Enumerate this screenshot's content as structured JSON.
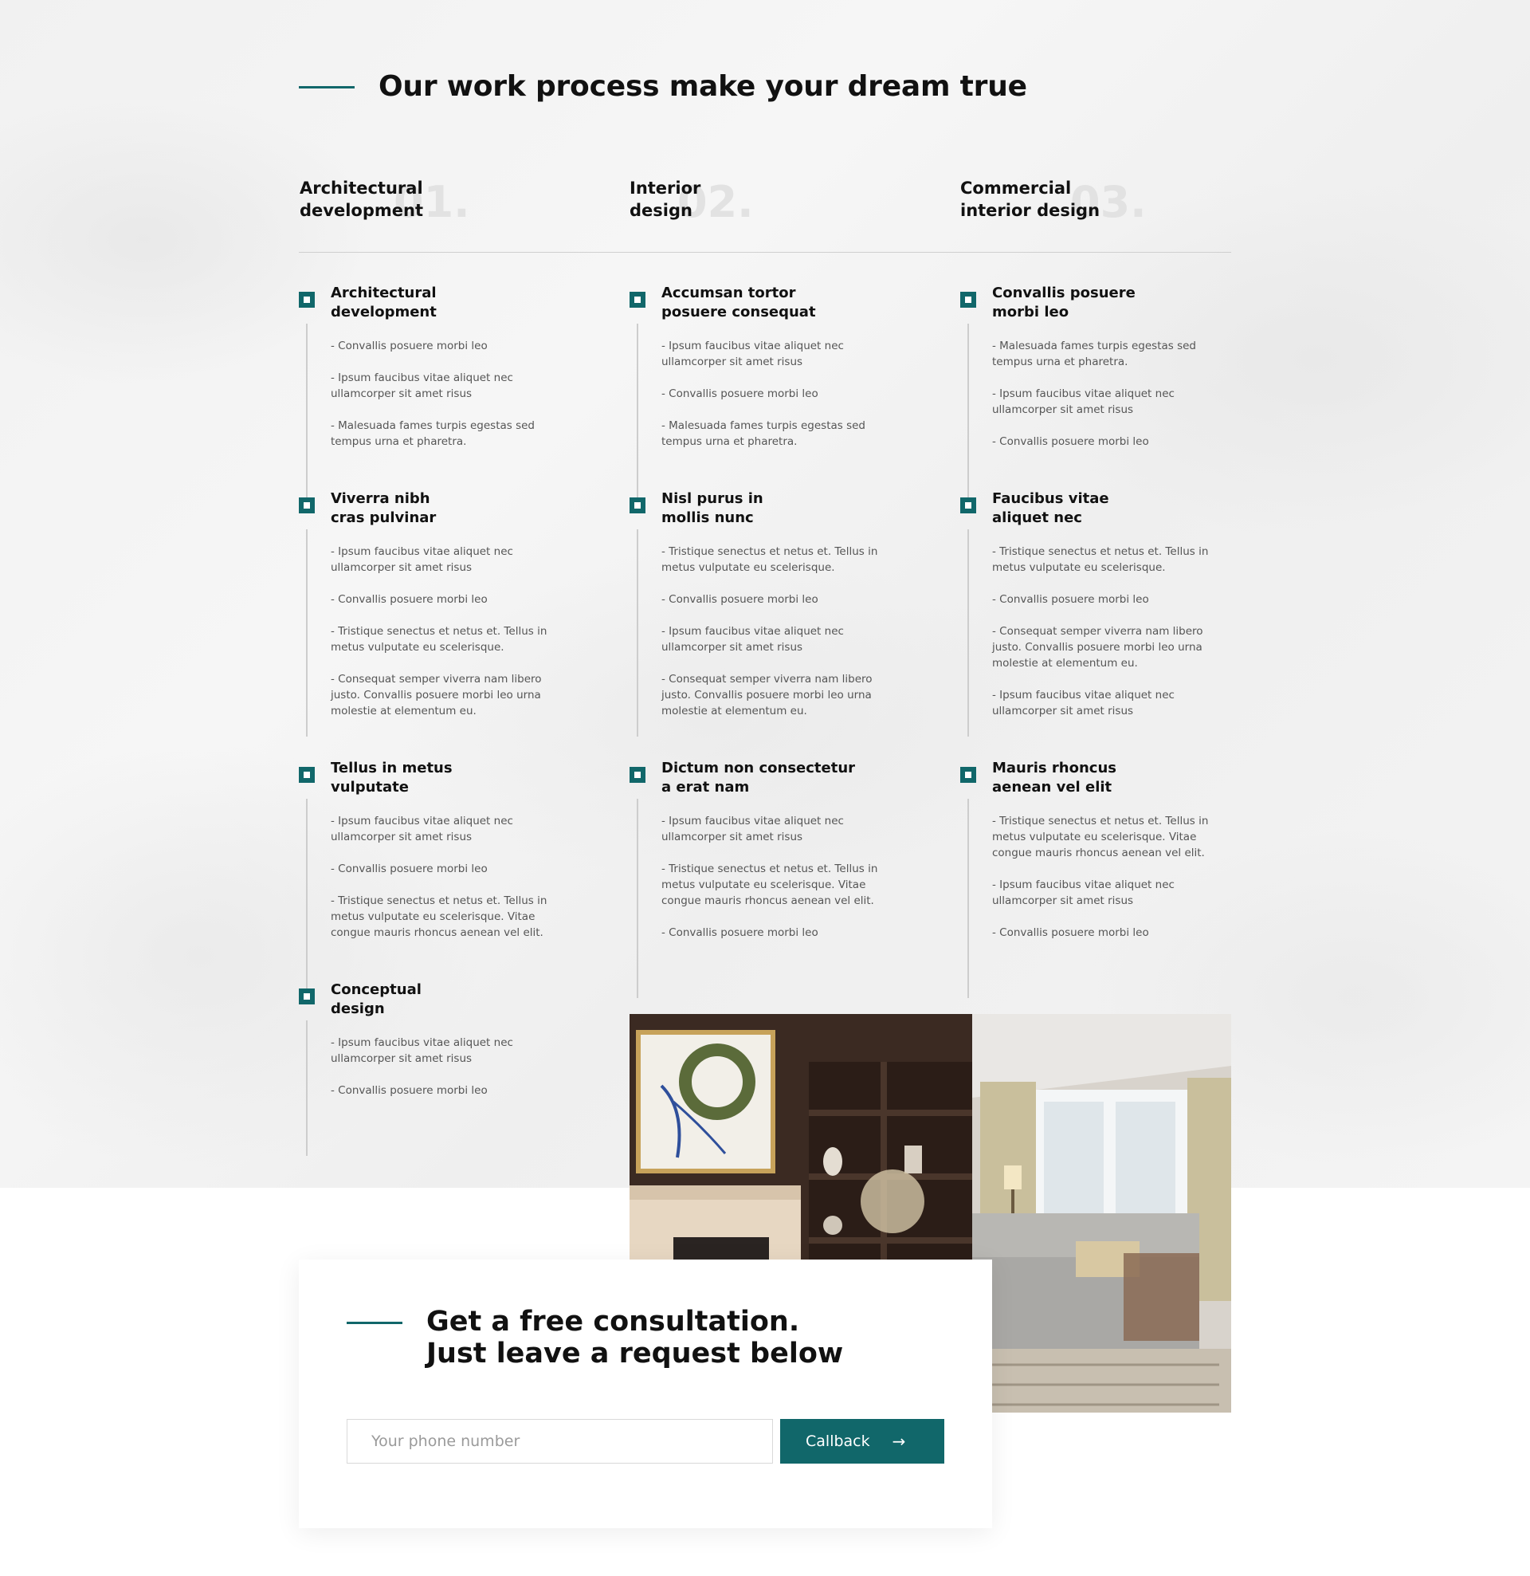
{
  "section": {
    "title": "Our work process make your dream true"
  },
  "colors": {
    "accent": "#11676a"
  },
  "categories": [
    {
      "number": "01.",
      "title": "Architectural\ndevelopment"
    },
    {
      "number": "02.",
      "title": "Interior\ndesign"
    },
    {
      "number": "03.",
      "title": "Commercial\ninterior design"
    }
  ],
  "columns": [
    {
      "steps": [
        {
          "title": "Architectural\ndevelopment",
          "items": [
            "- Convallis posuere morbi leo",
            "- Ipsum faucibus vitae aliquet nec ullamcorper sit amet risus",
            "- Malesuada fames turpis egestas sed tempus urna et pharetra."
          ]
        },
        {
          "title": "Viverra nibh\ncras pulvinar",
          "items": [
            "- Ipsum faucibus vitae aliquet nec ullamcorper sit amet risus",
            "- Convallis posuere morbi leo",
            "- Tristique senectus et netus et. Tellus in metus vulputate eu scelerisque.",
            "- Consequat semper viverra nam libero justo. Convallis posuere morbi leo urna molestie at elementum eu."
          ]
        },
        {
          "title": "Tellus in metus\nvulputate",
          "items": [
            "- Ipsum faucibus vitae aliquet nec ullamcorper sit amet risus",
            "- Convallis posuere morbi leo",
            "- Tristique senectus et netus et. Tellus in metus vulputate eu scelerisque. Vitae congue mauris rhoncus aenean vel elit."
          ]
        },
        {
          "title": "Conceptual\ndesign",
          "items": [
            "- Ipsum faucibus vitae aliquet nec ullamcorper sit amet risus",
            "- Convallis posuere morbi leo"
          ]
        }
      ]
    },
    {
      "steps": [
        {
          "title": "Accumsan tortor\nposuere consequat",
          "items": [
            "- Ipsum faucibus vitae aliquet nec ullamcorper sit amet risus",
            "- Convallis posuere morbi leo",
            "- Malesuada fames turpis egestas sed tempus urna et pharetra."
          ]
        },
        {
          "title": "Nisl purus in\nmollis nunc",
          "items": [
            "- Tristique senectus et netus et. Tellus in metus vulputate eu scelerisque.",
            "- Convallis posuere morbi leo",
            "- Ipsum faucibus vitae aliquet nec ullamcorper sit amet risus",
            "- Consequat semper viverra nam libero justo. Convallis posuere morbi leo urna molestie at elementum eu."
          ]
        },
        {
          "title": "Dictum non consectetur\na erat nam",
          "items": [
            "- Ipsum faucibus vitae aliquet nec ullamcorper sit amet risus",
            "- Tristique senectus et netus et. Tellus in metus vulputate eu scelerisque. Vitae congue mauris rhoncus aenean vel elit.",
            "- Convallis posuere morbi leo"
          ]
        }
      ]
    },
    {
      "steps": [
        {
          "title": "Convallis posuere\nmorbi leo",
          "items": [
            "- Malesuada fames turpis egestas sed tempus urna et pharetra.",
            "- Ipsum faucibus vitae aliquet nec ullamcorper sit amet risus",
            "- Convallis posuere morbi leo"
          ]
        },
        {
          "title": "Faucibus vitae\naliquet nec",
          "items": [
            "- Tristique senectus et netus et. Tellus in metus vulputate eu scelerisque.",
            "- Convallis posuere morbi leo",
            "- Consequat semper viverra nam libero justo. Convallis posuere morbi leo urna molestie at elementum eu.",
            "- Ipsum faucibus vitae aliquet nec ullamcorper sit amet risus"
          ]
        },
        {
          "title": "Mauris rhoncus\naenean vel elit",
          "items": [
            "- Tristique senectus et netus et. Tellus in metus vulputate eu scelerisque. Vitae congue mauris rhoncus aenean vel elit.",
            " - Ipsum faucibus vitae aliquet nec ullamcorper sit amet risus",
            "- Convallis posuere morbi leo"
          ]
        }
      ]
    }
  ],
  "consultation": {
    "title": "Get a free consultation.\nJust leave a request below",
    "phone_placeholder": "Your phone number",
    "phone_value": "",
    "button_label": "Callback",
    "button_icon": "arrow-right-icon"
  },
  "photo": {
    "subject": "living-room-interior-photo"
  }
}
